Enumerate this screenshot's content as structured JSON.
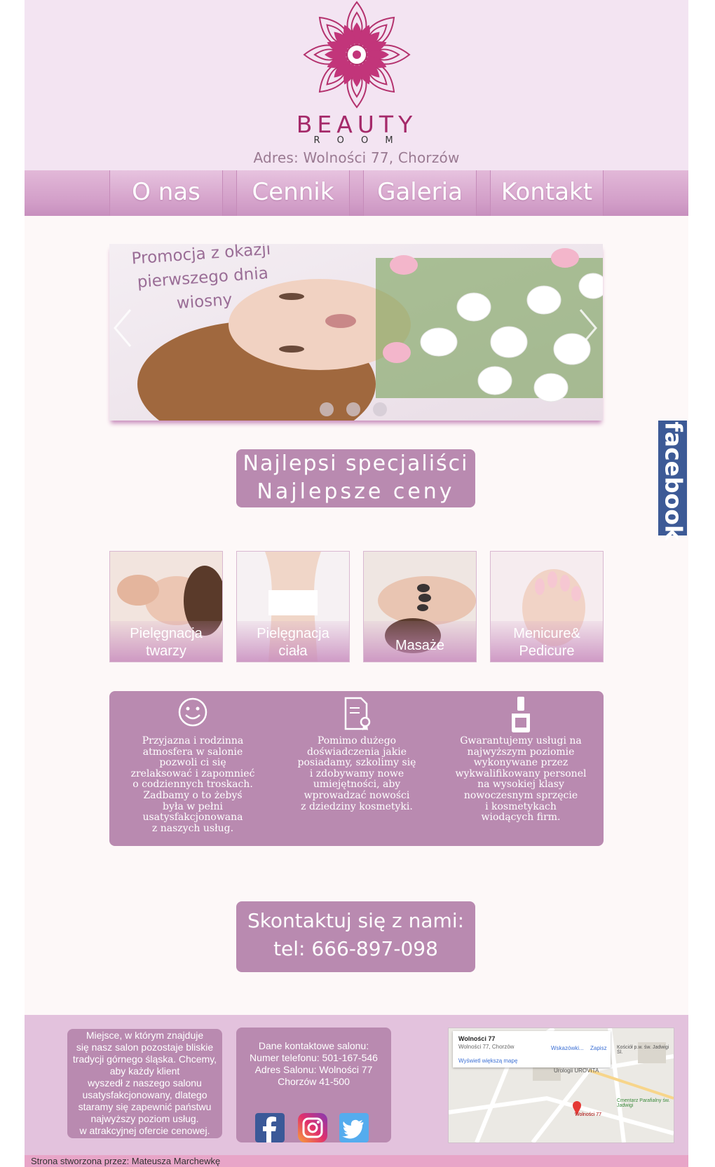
{
  "brand": {
    "logo_line1": "BEAUTY",
    "logo_line2": "R O O M",
    "address": "Adres: Wolności 77, Chorzów"
  },
  "nav": [
    {
      "label": "O nas"
    },
    {
      "label": "Cennik"
    },
    {
      "label": "Galeria"
    },
    {
      "label": "Kontakt"
    }
  ],
  "slider": {
    "promo": "Promocja z okazji pierwszego dnia wiosny",
    "slides": 3,
    "active": 0
  },
  "facebook_tab": "facebook",
  "specialists": {
    "line1": "Najlepsi specjaliści",
    "line2": "Najlepsze ceny"
  },
  "services": [
    {
      "line1": "Pielęgnacja",
      "line2": "twarzy"
    },
    {
      "line1": "Pielęgnacja",
      "line2": "ciała"
    },
    {
      "line1": "Masaże",
      "line2": ""
    },
    {
      "line1": "Menicure&",
      "line2": "Pedicure"
    }
  ],
  "features": [
    {
      "icon": "smiley-icon",
      "text": [
        "Przyjazna i rodzinna",
        "atmosfera w salonie",
        "pozwoli ci się",
        "zrelaksować  i zapomnieć",
        "o codziennych troskach.",
        "Zadbamy o to żebyś",
        "była w pełni",
        "usatysfakcjonowana",
        "z naszych usług."
      ]
    },
    {
      "icon": "certificate-icon",
      "text": [
        "Pomimo dużego",
        "doświadczenia jakie",
        "posiadamy, szkolimy się",
        "i zdobywamy nowe",
        "umiejętności, aby",
        "wprowadzać nowości",
        "z dziedziny kosmetyki."
      ]
    },
    {
      "icon": "nail-polish-icon",
      "text": [
        "Gwarantujemy usługi na",
        "najwyższym poziomie",
        "wykonywane przez",
        "wykwalifikowany personel",
        "na wysokiej klasy",
        "nowoczesnym sprzęcie",
        "i kosmetykach",
        "wiodących firm."
      ]
    }
  ],
  "contact": {
    "line1": "Skontaktuj się  z nami:",
    "line2": "tel: 666-897-098"
  },
  "footer": {
    "about": [
      "Miejsce, w którym znajduje",
      "się nasz salon pozostaje bliskie",
      "tradycji górnego śląska. Chcemy,",
      "aby każdy klient",
      "wyszedł z naszego salonu",
      "usatysfakcjonowany, dlatego",
      "staramy się zapewnić państwu",
      "najwyższy poziom usług.",
      "w atrakcyjnej ofercie cenowej."
    ],
    "contact_data": [
      "Dane kontaktowe salonu:",
      "Numer telefonu: 501-167-546",
      "Adres Salonu: Wolności 77",
      "Chorzów 41-500"
    ],
    "map": {
      "title": "Wolności 77",
      "subtitle": "Wolności 77, Chorzów",
      "directions": "Wskazówki...",
      "save": "Zapisz",
      "larger_map": "Wyświetl większą mapę",
      "pin_label": "Wolności 77",
      "poi1": "Urologii UROVITA",
      "poi2": "Kościół p.w. św. Jadwigi Śl.",
      "poi3": "Cmentarz Parafialny św. Jadwigi"
    },
    "credit": "Strona stworzona przez: Mateusza Marchewkę"
  },
  "colors": {
    "accent": "#b98ab0",
    "nav": "#d6a5cd",
    "header_bg": "#f3e4f2",
    "facebook": "#3d5a96"
  }
}
